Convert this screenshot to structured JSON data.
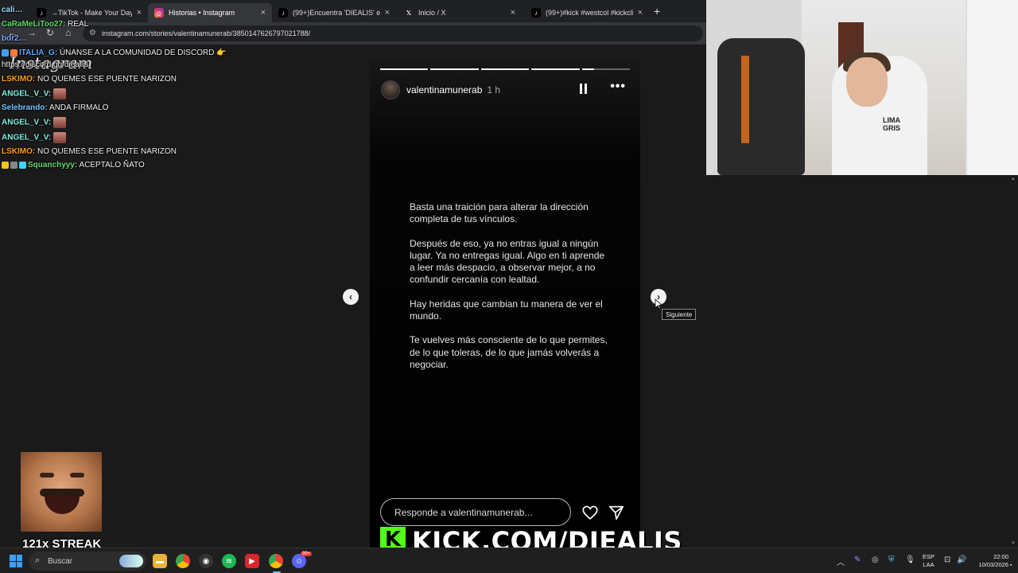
{
  "browser": {
    "tabs": [
      {
        "title": "→TikTok - Make Your Day",
        "icon": "tiktok-icon",
        "active": false
      },
      {
        "title": "Historias • Instagram",
        "icon": "instagram-icon",
        "active": true
      },
      {
        "title": "(99+)Encuentra 'DIEALIS' en Tik",
        "icon": "tiktok-icon",
        "active": false
      },
      {
        "title": "Inicio / X",
        "icon": "x-icon",
        "active": false
      },
      {
        "title": "(99+)#kick #westcol #kickclips",
        "icon": "tiktok-icon",
        "active": false
      }
    ],
    "new_tab": "+",
    "close": "×",
    "url": "instagram.com/stories/valentinamunerab/3850147626797021788/"
  },
  "instagram": {
    "logo": "Instagram"
  },
  "story": {
    "username": "valentinamunerab",
    "time": "1 h",
    "progress": [
      1,
      1,
      1,
      1,
      0.25
    ],
    "paragraphs": [
      "Basta una traición para alterar la dirección completa de tus vínculos.",
      "Después de eso, ya no entras igual a ningún lugar. Ya no entregas igual. Algo en ti aprende a leer más despacio, a observar mejor, a no confundir cercanía con lealtad.",
      "Hay heridas que cambian tu manera de ver el mundo.",
      "Te vuelves más consciente de lo que permites, de lo que toleras, de lo que jamás volverás a negociar."
    ],
    "reply_placeholder": "Responde a valentinamunerab...",
    "next_tooltip": "Siguiente"
  },
  "chat": [
    {
      "user": "cali…",
      "text": "",
      "color": "#9adcff"
    },
    {
      "user": "CaRaMeLiToo27:",
      "text": "REAL",
      "color": "#62d96b"
    },
    {
      "user": "bdr2…",
      "text": "",
      "color": "#7aa7ff"
    },
    {
      "user": "ITALIA_G:",
      "text": "ÚNANSE A LA COMUNIDAD DE DISCORD 👉",
      "color": "#5aa8ff"
    },
    {
      "user": "",
      "text": "https://discord.gg/dieallis",
      "color": "#ffffff"
    },
    {
      "user": "LSKIMO:",
      "text": "NO QUEMES ESE PUENTE NARIZON",
      "color": "#ff9f1a"
    },
    {
      "user": "ANGEL_V_V:",
      "text": "",
      "color": "#7ff0e0"
    },
    {
      "user": "Selebrando:",
      "text": "ANDA FIRMALO",
      "color": "#74c2ff"
    },
    {
      "user": "ANGEL_V_V:",
      "text": "",
      "color": "#7ff0e0"
    },
    {
      "user": "ANGEL_V_V:",
      "text": "",
      "color": "#7ff0e0"
    },
    {
      "user": "LSKIMO:",
      "text": "NO QUEMES ESE PUENTE NARIZON",
      "color": "#ff9f1a"
    },
    {
      "user": "Squanchyyy:",
      "text": "ACEPTALO ÑATO",
      "color": "#62d96b"
    }
  ],
  "overlay": {
    "streak": "121x STREAK",
    "kick_logo": "K",
    "kick_text": "KICK.COM/DIEALIS",
    "webcam_shirt": "LIMA\nGRIS"
  },
  "taskbar": {
    "search": "Buscar",
    "lang_top": "ESP",
    "lang_bottom": "LAA",
    "time": "22:00",
    "date": "10/03/2026",
    "badge": "99+"
  },
  "colors": {
    "kick_green": "#53fc18",
    "instagram_pink": "#e1306c",
    "windows_blue": "#3aa0ff"
  }
}
